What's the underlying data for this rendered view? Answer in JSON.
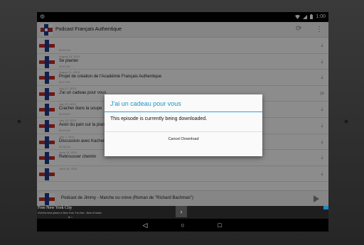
{
  "status_bar": {
    "time": "1:00"
  },
  "app": {
    "title": "Podcast Français Authentique",
    "refresh_icon": "refresh-icon",
    "menu_icon": "overflow-menu-icon"
  },
  "episodes": [
    {
      "date": "",
      "title": "",
      "duration": "00:10:18"
    },
    {
      "date": "August 23, 2013",
      "title": "Se planter",
      "duration": "00:11:04"
    },
    {
      "date": "August 11, 2013",
      "title": "Projet de création de l'Académie Français Authentique",
      "duration": "00:17:03"
    },
    {
      "date": "July 27, 2013",
      "title": "J'ai un cadeau pour vous",
      "duration": ""
    },
    {
      "date": "July 20, 2013",
      "title": "Cracher dans la soupe",
      "duration": "00:16:02"
    },
    {
      "date": "July 13, 2013",
      "title": "Avoir du pain sur la planche",
      "duration": "00:10:46"
    },
    {
      "date": "July 7, 2013",
      "title": "Discussion avec Kacher Pipita",
      "duration": "00:34:16"
    },
    {
      "date": "June 23, 2013",
      "title": "Rebrousser chemin",
      "duration": ""
    },
    {
      "date": "June 29, 2013",
      "title": "",
      "duration": ""
    }
  ],
  "player": {
    "title": "Podcast de Jimmy - Marche ou crève (Roman de \"Richard Bachman\")"
  },
  "dialog": {
    "title": "J'ai un cadeau pour vous",
    "message": "This episode is currently being downloaded.",
    "cancel_label": "Cancel Download"
  },
  "ad": {
    "title": "Free New York City",
    "subtitle": "Visit the best places in New York. Fun free - Best of hotels"
  },
  "colors": {
    "accent": "#2196c4",
    "divider": "#2aa5d8"
  }
}
